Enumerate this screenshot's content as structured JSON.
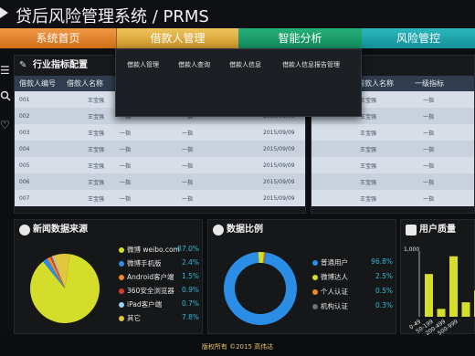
{
  "app": {
    "title": "贷后风险管理系统 / PRMS"
  },
  "nav": {
    "tabs": [
      {
        "label": "系统首页"
      },
      {
        "label": "借款人管理"
      },
      {
        "label": "智能分析"
      },
      {
        "label": "风险管控"
      }
    ]
  },
  "dropdown": {
    "items": [
      {
        "label": "借款人管理"
      },
      {
        "label": "借款人查询"
      },
      {
        "label": "借款人信息"
      },
      {
        "label": "借款人信息报告管理"
      }
    ]
  },
  "left_panel": {
    "title": "行业指标配置",
    "columns": [
      "借款人编号",
      "借款人名称",
      "",
      "",
      ""
    ],
    "rows": [
      [
        "001",
        "王宝强",
        "一指",
        "一指",
        "2015/09/09"
      ],
      [
        "002",
        "王宝强",
        "一指",
        "一指",
        "2015/09/09"
      ],
      [
        "003",
        "王宝强",
        "一指",
        "一指",
        "2015/09/09"
      ],
      [
        "004",
        "王宝强",
        "一指",
        "一指",
        "2015/09/09"
      ],
      [
        "005",
        "王宝强",
        "一指",
        "一指",
        "2015/09/09"
      ],
      [
        "006",
        "王宝强",
        "一指",
        "一指",
        "2015/09/09"
      ],
      [
        "007",
        "王宝强",
        "一指",
        "一指",
        "2015/09/09"
      ]
    ]
  },
  "right_panel": {
    "columns": [
      "借款人名称",
      "一级指标",
      ""
    ],
    "rows": [
      [
        "王宝强",
        "一指",
        ""
      ],
      [
        "王宝强",
        "一指",
        ""
      ],
      [
        "王宝强",
        "一指",
        ""
      ],
      [
        "王宝强",
        "一指",
        ""
      ],
      [
        "王宝强",
        "一指",
        ""
      ],
      [
        "王宝强",
        "一指",
        ""
      ],
      [
        "王宝强",
        "一指",
        ""
      ]
    ]
  },
  "news_panel": {
    "title": "新闻数据来源",
    "items": [
      {
        "label": "微博 weibo.com",
        "value": "87.0%",
        "color": "#d4de2a"
      },
      {
        "label": "微博手机版",
        "value": "2.4%",
        "color": "#2a8ee6"
      },
      {
        "label": "Android客户端",
        "value": "1.5%",
        "color": "#ef8b1f"
      },
      {
        "label": "360安全浏览器",
        "value": "0.9%",
        "color": "#dc3b2c"
      },
      {
        "label": "iPad客户端",
        "value": "0.7%",
        "color": "#9ad4ef"
      },
      {
        "label": "其它",
        "value": "7.8%",
        "color": "#e2c63c"
      }
    ]
  },
  "ratio_panel": {
    "title": "数据比例",
    "items": [
      {
        "label": "普通用户",
        "value": "96.8%",
        "color": "#2a8ee6"
      },
      {
        "label": "微博达人",
        "value": "2.5%",
        "color": "#d4de2a"
      },
      {
        "label": "个人认证",
        "value": "0.5%",
        "color": "#ef8b1f"
      },
      {
        "label": "机构认证",
        "value": "0.3%",
        "color": "#6b7078"
      }
    ]
  },
  "quality_panel": {
    "title": "用户质量",
    "y_top_label": "1,000",
    "categories": [
      "0-49",
      "50-199",
      "200-499",
      "500-999"
    ]
  },
  "chart_data": [
    {
      "type": "pie",
      "title": "新闻数据来源",
      "categories": [
        "微博 weibo.com",
        "微博手机版",
        "Android客户端",
        "360安全浏览器",
        "iPad客户端",
        "其它"
      ],
      "values": [
        87.0,
        2.4,
        1.5,
        0.9,
        0.7,
        7.8
      ]
    },
    {
      "type": "pie",
      "title": "数据比例",
      "categories": [
        "普通用户",
        "微博达人",
        "个人认证",
        "机构认证"
      ],
      "values": [
        96.8,
        2.5,
        0.5,
        0.3
      ]
    },
    {
      "type": "bar",
      "title": "用户质量",
      "categories": [
        "0-49",
        "50-199",
        "200-499",
        "500-999",
        ""
      ],
      "values": [
        650,
        120,
        920,
        220,
        400
      ],
      "ylim": [
        0,
        1000
      ]
    }
  ],
  "footer": {
    "text": "版权所有 ©2015 高伟达"
  }
}
